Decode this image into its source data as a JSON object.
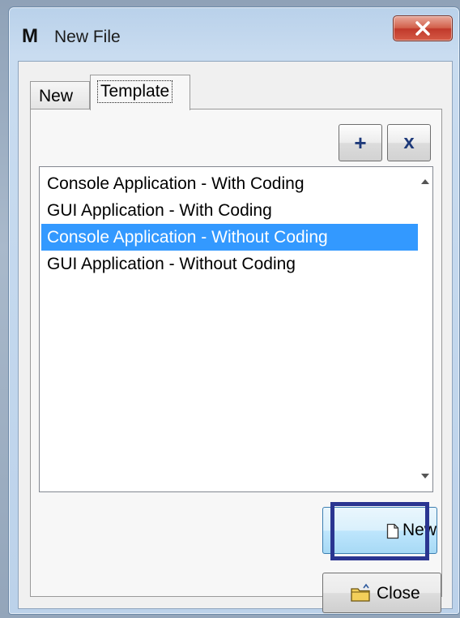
{
  "window": {
    "app_icon_letter": "M",
    "title": "New File",
    "close_icon": "close-x-icon"
  },
  "tabs": [
    {
      "label": "New",
      "active": false
    },
    {
      "label": "Template",
      "active": true
    }
  ],
  "toolbar": {
    "add_label": "+",
    "remove_label": "x"
  },
  "templates": {
    "items": [
      "Console Application - With Coding",
      "GUI Application - With Coding",
      "Console Application - Without Coding",
      "GUI Application - Without Coding"
    ],
    "selected_index": 2
  },
  "buttons": {
    "new_label": "New",
    "new_icon": "document-icon",
    "close_label": "Close",
    "close_icon": "folder-icon"
  },
  "colors": {
    "selection": "#3399ff",
    "highlight_border": "#2a3591",
    "title_close": "#c0392b"
  }
}
